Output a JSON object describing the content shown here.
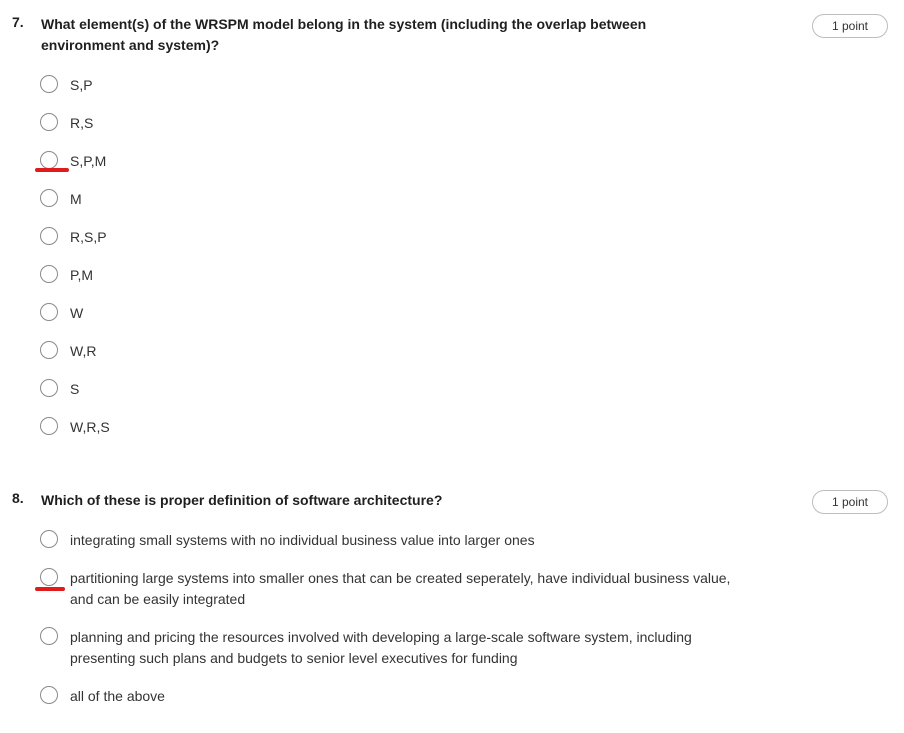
{
  "questions": [
    {
      "number": "7.",
      "text": "What element(s) of the WRSPM model belong in the system (including the overlap between environment and system)?",
      "points": "1 point",
      "options": [
        "S,P",
        "R,S",
        "S,P,M",
        "M",
        "R,S,P",
        "P,M",
        "W",
        "W,R",
        "S",
        "W,R,S"
      ],
      "marked_option": "S,P,M"
    },
    {
      "number": "8.",
      "text": "Which of these is proper definition of software architecture?",
      "points": "1 point",
      "options": [
        "integrating small systems with no individual business value into larger ones",
        "partitioning large systems into smaller ones that can be created seperately, have individual business value, and can be easily integrated",
        "planning and pricing the resources involved with developing a large-scale software system, including presenting such plans and budgets to senior level executives for funding",
        "all of the above"
      ],
      "marked_option": "partitioning large systems into smaller ones that can be created seperately, have individual business value, and can be easily integrated"
    }
  ],
  "colors": {
    "annotation": "#e01b1b",
    "radio_border": "#8a8a8a"
  }
}
